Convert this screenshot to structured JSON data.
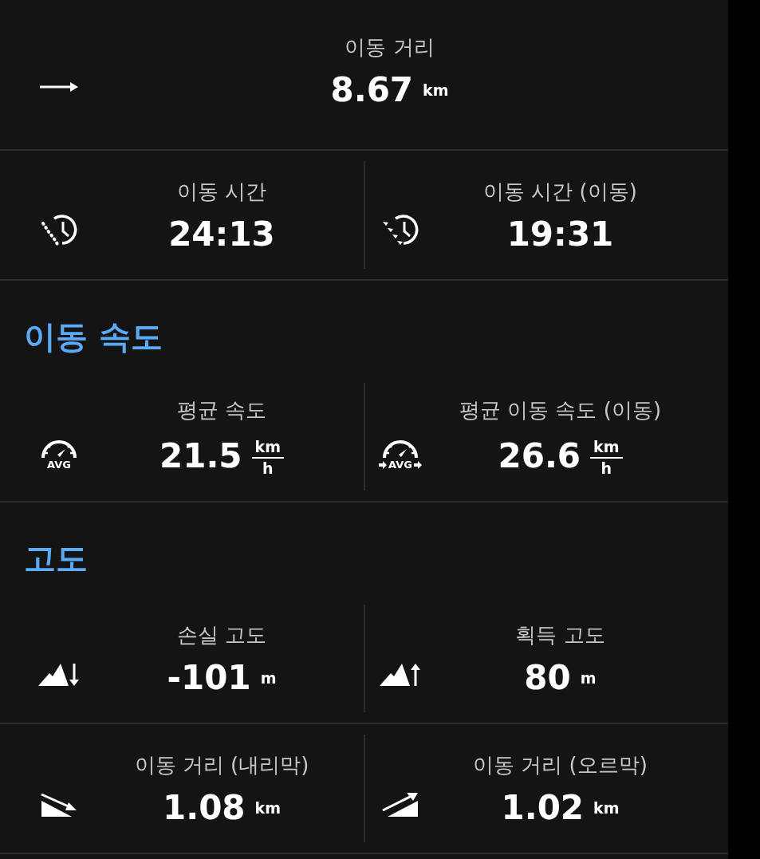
{
  "sections": [
    {
      "kind": "single",
      "stats": [
        {
          "kind": "arrow-right",
          "label": "이동 거리",
          "value": "8.67",
          "unit": "km"
        }
      ]
    },
    {
      "kind": "pair",
      "stats": [
        {
          "kind": "clock-dots",
          "label": "이동 시간",
          "value": "24:13"
        },
        {
          "kind": "clock-arrows",
          "label": "이동 시간 (이동)",
          "value": "19:31"
        }
      ]
    },
    {
      "kind": "heading",
      "title": "이동 속도"
    },
    {
      "kind": "pair",
      "stats": [
        {
          "kind": "gauge",
          "badge": "AVG",
          "label": "평균 속도",
          "value": "21.5",
          "unit_top": "km",
          "unit_bottom": "h"
        },
        {
          "kind": "gauge-arrows",
          "badge": "AVG",
          "label": "평균 이동 속도 (이동)",
          "value": "26.6",
          "unit_top": "km",
          "unit_bottom": "h"
        }
      ]
    },
    {
      "kind": "heading",
      "title": "고도"
    },
    {
      "kind": "pair",
      "stats": [
        {
          "kind": "mountain-down",
          "label": "손실 고도",
          "value": "-101",
          "unit": "m"
        },
        {
          "kind": "mountain-up",
          "label": "획득 고도",
          "value": "80",
          "unit": "m"
        }
      ]
    },
    {
      "kind": "pair",
      "stats": [
        {
          "kind": "slope-down",
          "label": "이동 거리 (내리막)",
          "value": "1.08",
          "unit": "km"
        },
        {
          "kind": "slope-up",
          "label": "이동 거리 (오르막)",
          "value": "1.02",
          "unit": "km"
        }
      ]
    }
  ]
}
